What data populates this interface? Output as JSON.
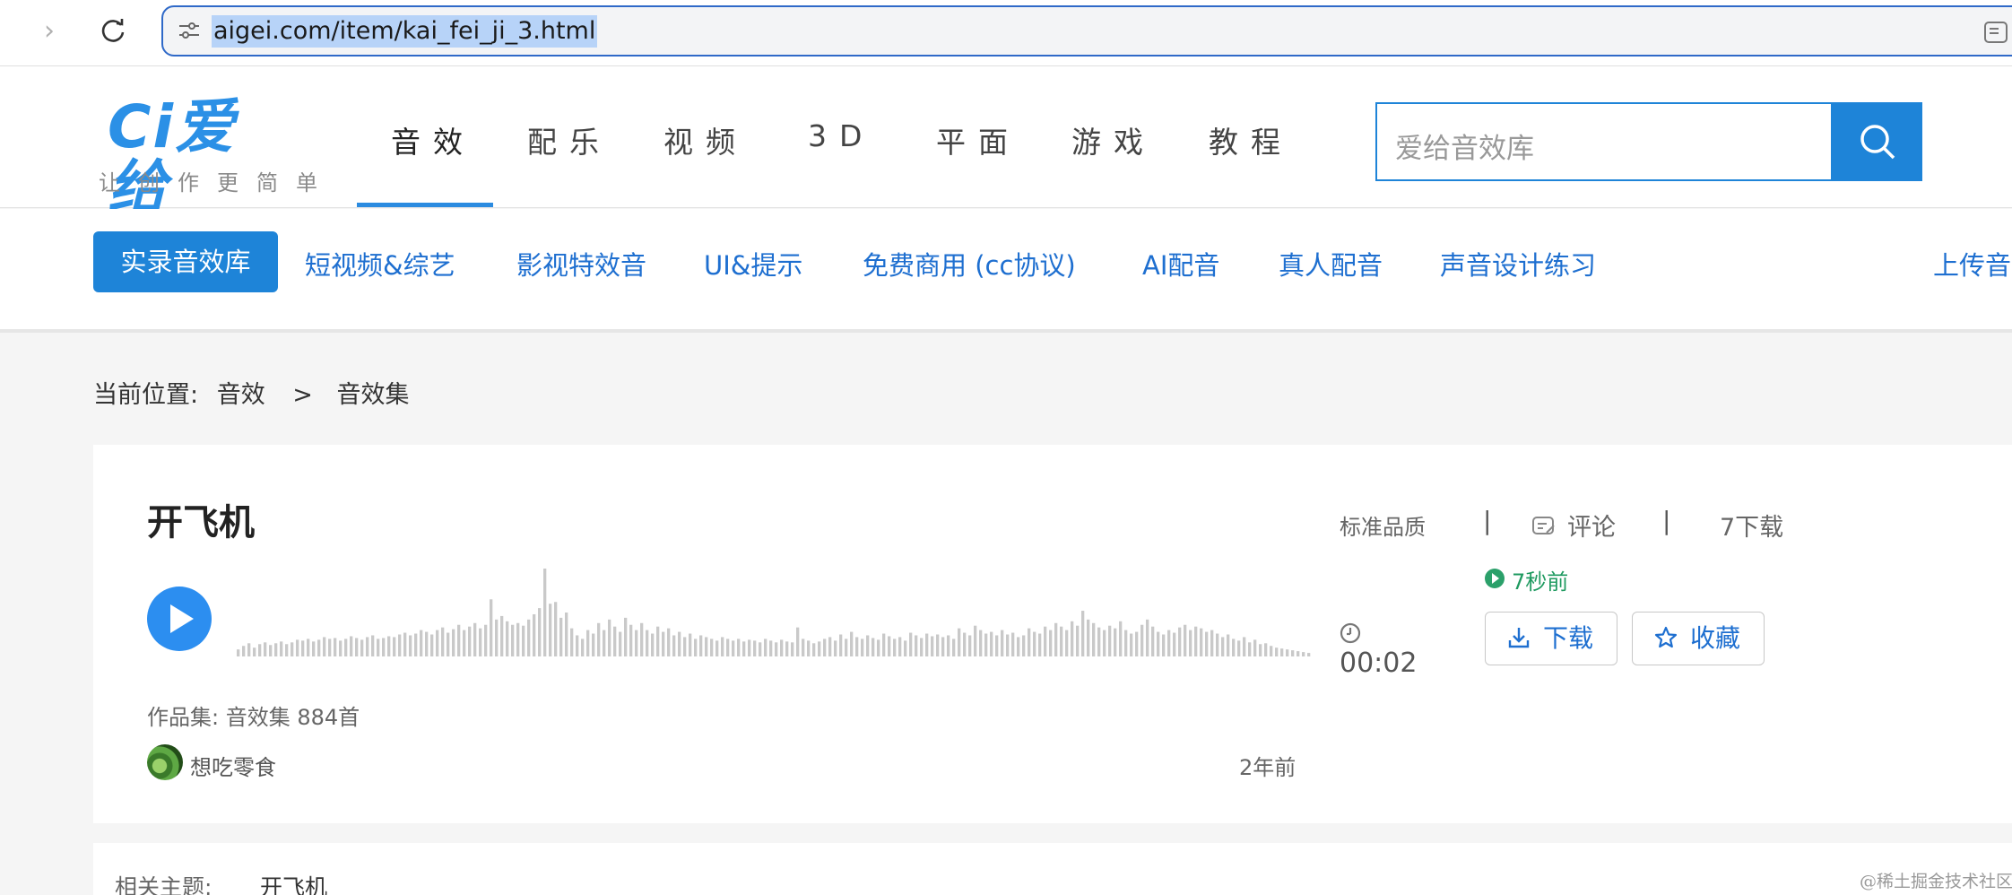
{
  "browser": {
    "url": "aigei.com/item/kai_fei_ji_3.html"
  },
  "header": {
    "logo_text": "Ci爱给",
    "slogan": "让创作更简单",
    "nav": [
      "音效",
      "配乐",
      "视频",
      "3D",
      "平面",
      "游戏",
      "教程"
    ],
    "active_nav": "音效",
    "search_placeholder": "爱给音效库"
  },
  "sub_nav": {
    "items": [
      "实录音效库",
      "短视频&综艺",
      "影视特效音",
      "UI&提示",
      "免费商用 (cc协议)",
      "AI配音",
      "真人配音",
      "声音设计练习"
    ],
    "upload": "上传音"
  },
  "breadcrumb": {
    "label": "当前位置:",
    "items": [
      "音效",
      "音效集"
    ],
    "separator": ">"
  },
  "item": {
    "title": "开飞机",
    "duration": "00:02",
    "collection_label": "作品集:",
    "collection_name": "音效集 884首",
    "author": "想吃零食",
    "posted": "2年前",
    "quality": "标准品质",
    "comments": "评论",
    "downloads": "7下载",
    "recent": "7秒前",
    "download_button": "下载",
    "favorite_button": "收藏",
    "meta_separator": "|",
    "waveform_levels": [
      0.08,
      0.12,
      0.15,
      0.1,
      0.14,
      0.16,
      0.13,
      0.15,
      0.17,
      0.14,
      0.16,
      0.19,
      0.18,
      0.2,
      0.17,
      0.19,
      0.22,
      0.2,
      0.21,
      0.18,
      0.2,
      0.23,
      0.21,
      0.19,
      0.22,
      0.24,
      0.2,
      0.21,
      0.23,
      0.22,
      0.25,
      0.27,
      0.24,
      0.26,
      0.3,
      0.28,
      0.25,
      0.3,
      0.33,
      0.27,
      0.31,
      0.36,
      0.3,
      0.34,
      0.38,
      0.32,
      0.36,
      0.65,
      0.42,
      0.46,
      0.4,
      0.36,
      0.38,
      0.35,
      0.42,
      0.48,
      0.55,
      1.0,
      0.6,
      0.62,
      0.44,
      0.5,
      0.32,
      0.24,
      0.2,
      0.3,
      0.26,
      0.38,
      0.3,
      0.42,
      0.34,
      0.28,
      0.44,
      0.36,
      0.3,
      0.38,
      0.3,
      0.26,
      0.34,
      0.28,
      0.32,
      0.24,
      0.28,
      0.22,
      0.26,
      0.2,
      0.24,
      0.22,
      0.2,
      0.18,
      0.22,
      0.2,
      0.18,
      0.2,
      0.17,
      0.19,
      0.18,
      0.16,
      0.2,
      0.18,
      0.16,
      0.19,
      0.17,
      0.16,
      0.33,
      0.2,
      0.18,
      0.15,
      0.17,
      0.2,
      0.22,
      0.18,
      0.25,
      0.2,
      0.28,
      0.22,
      0.2,
      0.24,
      0.21,
      0.19,
      0.26,
      0.23,
      0.2,
      0.22,
      0.18,
      0.27,
      0.24,
      0.21,
      0.26,
      0.23,
      0.25,
      0.22,
      0.24,
      0.2,
      0.32,
      0.27,
      0.24,
      0.35,
      0.3,
      0.26,
      0.28,
      0.24,
      0.3,
      0.25,
      0.27,
      0.22,
      0.24,
      0.32,
      0.28,
      0.26,
      0.34,
      0.3,
      0.38,
      0.34,
      0.3,
      0.4,
      0.35,
      0.52,
      0.42,
      0.38,
      0.33,
      0.3,
      0.35,
      0.32,
      0.4,
      0.3,
      0.26,
      0.28,
      0.36,
      0.42,
      0.34,
      0.28,
      0.25,
      0.3,
      0.27,
      0.33,
      0.36,
      0.3,
      0.34,
      0.32,
      0.28,
      0.3,
      0.26,
      0.22,
      0.25,
      0.2,
      0.18,
      0.22,
      0.16,
      0.19,
      0.14,
      0.15,
      0.12,
      0.1,
      0.09,
      0.08,
      0.07,
      0.06,
      0.05,
      0.04
    ]
  },
  "related": {
    "label": "相关主题:",
    "value": "开飞机"
  },
  "watermark": "@稀土掘金技术社区",
  "colors": {
    "brand_blue": "#1e84d8",
    "link_blue": "#1e6fd0",
    "play_blue": "#2c8ef0",
    "recent_green": "#1f9a60"
  }
}
